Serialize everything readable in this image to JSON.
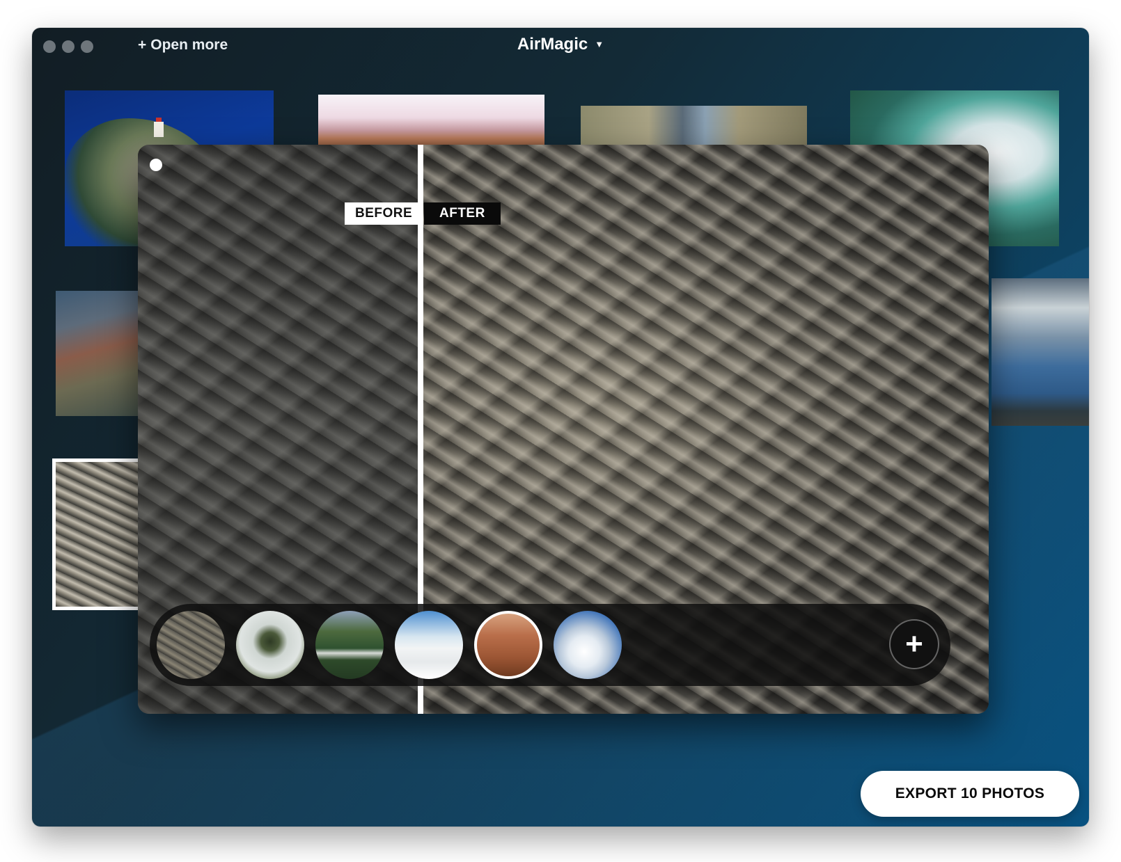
{
  "window": {
    "title": "AirMagic",
    "title_caret": "▼",
    "open_more": {
      "icon": "+",
      "label": "Open more"
    }
  },
  "gallery": {
    "thumbnails": [
      {
        "subject": "lighthouse-cliff"
      },
      {
        "subject": "pink-desert-horizon"
      },
      {
        "subject": "canyon"
      },
      {
        "subject": "waterfall"
      },
      {
        "subject": "colorful-mountains"
      },
      {
        "subject": "cloudy-sky"
      },
      {
        "subject": "badlands-selected"
      }
    ]
  },
  "compare": {
    "before_label": "BEFORE",
    "after_label": "AFTER"
  },
  "presets": {
    "items": [
      {
        "name": "badlands"
      },
      {
        "name": "lone-tree-fog"
      },
      {
        "name": "forest-road"
      },
      {
        "name": "bridge-in-clouds"
      },
      {
        "name": "desert-dunes",
        "selected": true
      },
      {
        "name": "puffy-clouds"
      }
    ],
    "add_icon": "+"
  },
  "export": {
    "label": "EXPORT 10 PHOTOS"
  }
}
